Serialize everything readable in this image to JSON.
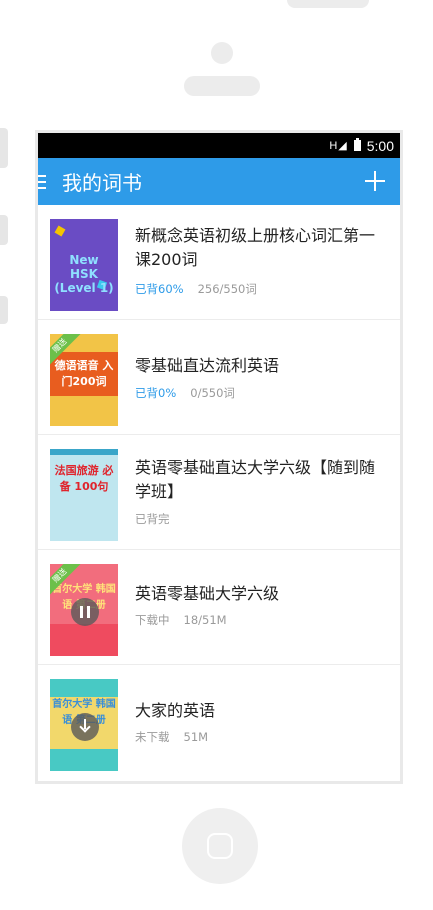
{
  "status_bar": {
    "signal": "H",
    "time": "5:00"
  },
  "app_bar": {
    "title": "我的词书"
  },
  "books": [
    {
      "cover_text": "New HSK (Level 1)",
      "title": "新概念英语初级上册核心词汇第一课200词",
      "status": "已背60%",
      "progress": "256/550词",
      "ribbon": "",
      "progress_fraction": 0.6
    },
    {
      "cover_text": "德语语音 入门200词",
      "title": "零基础直达流利英语",
      "status": "已背0%",
      "progress": "0/550词",
      "ribbon": "赠送",
      "progress_fraction": 0
    },
    {
      "cover_text": "法国旅游 必备 100句",
      "title": "英语零基础直达大学六级【随到随学班】",
      "status": "已背完",
      "progress": "",
      "ribbon": ""
    },
    {
      "cover_text": "首尔大学 韩国语 第二册",
      "title": "英语零基础大学六级",
      "status": "下载中",
      "progress": "18/51M",
      "ribbon": "赠送"
    },
    {
      "cover_text": "首尔大学 韩国语 第二册",
      "title": "大家的英语",
      "status": "未下载",
      "progress": "51M",
      "ribbon": ""
    }
  ]
}
